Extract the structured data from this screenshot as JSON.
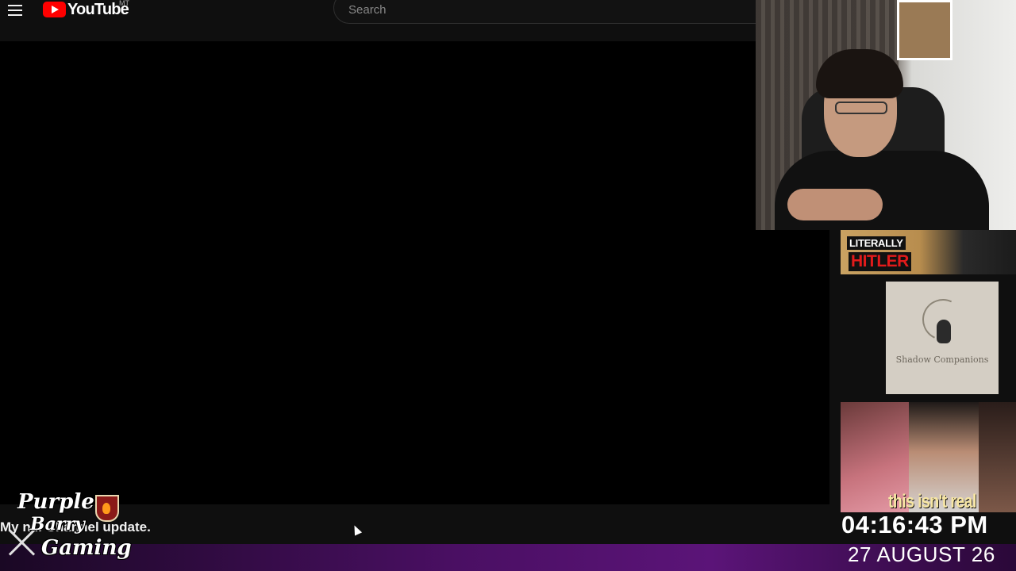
{
  "header": {
    "logo_text": "YouTube",
    "country_code": "MT",
    "search_placeholder": "Search"
  },
  "video": {
    "title": "My n... Channel update."
  },
  "channel_logo": {
    "line1": "Purple",
    "line2": "Barry",
    "line3": "Gaming"
  },
  "sidebar_thumbnails": [
    {
      "label_top": "LITERALLY",
      "label_bottom": "HITLER"
    },
    {
      "brand": "Shadow Companions"
    },
    {
      "caption": "this isn't real"
    }
  ],
  "clock": {
    "time": "04:16:43 PM",
    "date": "27 AUGUST 26"
  },
  "colors": {
    "brand_red": "#ff0000",
    "background": "#0f0f0f",
    "strip_purple": "#5b1478"
  }
}
